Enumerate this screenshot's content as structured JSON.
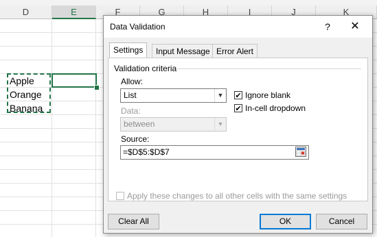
{
  "sheet": {
    "columns": [
      "D",
      "E",
      "F",
      "G",
      "H",
      "I",
      "J",
      "K"
    ],
    "cells": [
      "Apple",
      "Orange",
      "Banana"
    ]
  },
  "dialog": {
    "title": "Data Validation",
    "help": "?",
    "close": "✕",
    "tabs": [
      "Settings",
      "Input Message",
      "Error Alert"
    ],
    "group_label": "Validation criteria",
    "allow": {
      "label": "Allow:",
      "value": "List"
    },
    "ignore_blank": {
      "label": "Ignore blank",
      "checked": true
    },
    "in_cell_dropdown": {
      "label": "In-cell dropdown",
      "checked": true
    },
    "data": {
      "label": "Data:",
      "value": "between"
    },
    "source": {
      "label": "Source:",
      "value": "=$D$5:$D$7"
    },
    "apply_all": {
      "label": "Apply these changes to all other cells with the same settings",
      "checked": false
    },
    "buttons": {
      "clear_all": "Clear All",
      "ok": "OK",
      "cancel": "Cancel"
    },
    "colors": {
      "accent": "#0078d7",
      "excel_green": "#217346"
    }
  }
}
